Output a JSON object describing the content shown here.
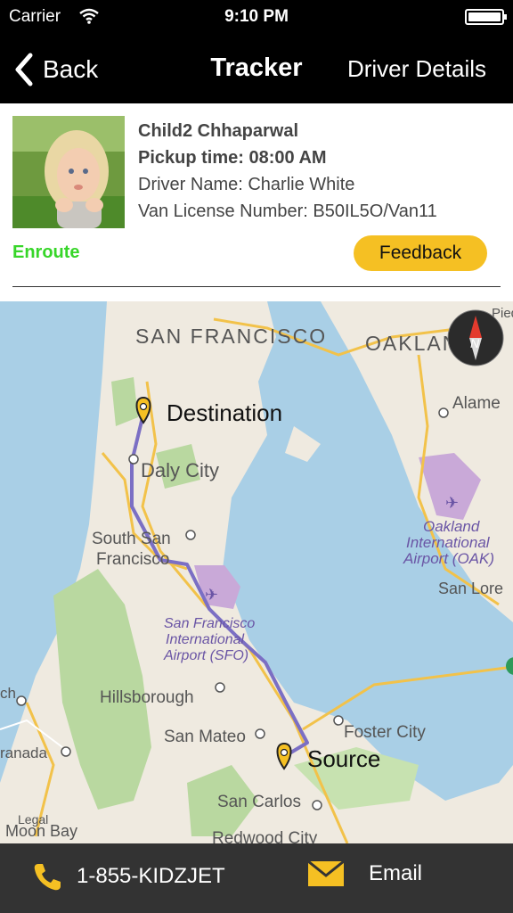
{
  "status_bar": {
    "carrier": "Carrier",
    "time": "9:10 PM"
  },
  "nav": {
    "back_label": "Back",
    "title": "Tracker",
    "right_label": "Driver Details"
  },
  "child": {
    "name": "Child2 Chhaparwal",
    "pickup_time": "Pickup time: 08:00 AM",
    "driver_name": "Driver Name:  Charlie White",
    "van_license": "Van License Number:  B50IL5O/Van11"
  },
  "trip_status": "Enroute",
  "feedback_label": "Feedback",
  "map": {
    "destination_label": "Destination",
    "source_label": "Source",
    "places": {
      "san_francisco": "SAN FRANCISCO",
      "oakland": "OAKLAN",
      "alameda": "Alame",
      "daly_city": "Daly City",
      "south_sf_1": "South San",
      "south_sf_2": "Francisco",
      "oak_airport_1": "Oakland",
      "oak_airport_2": "International",
      "oak_airport_3": "Airport (OAK)",
      "san_lorenzo": "San Lore",
      "sfo_1": "San Francisco",
      "sfo_2": "International",
      "sfo_3": "Airport (SFO)",
      "hillsborough": "Hillsborough",
      "san_mateo": "San Mateo",
      "foster_city": "Foster City",
      "granada": "ranada",
      "san_carlos": "San Carlos",
      "moon_bay": "Moon Bay",
      "legal": "Legal",
      "redwood_city": "Redwood City",
      "pied": "Pied",
      "ch": "ch"
    },
    "compass_label": "N"
  },
  "bottom_bar": {
    "phone": "1-855-KIDZJET",
    "email": "Email"
  },
  "colors": {
    "accent": "#f5c023",
    "enroute": "#37d629",
    "route": "#7b6fc4",
    "water": "#a9cfe6",
    "land": "#efeae0"
  }
}
